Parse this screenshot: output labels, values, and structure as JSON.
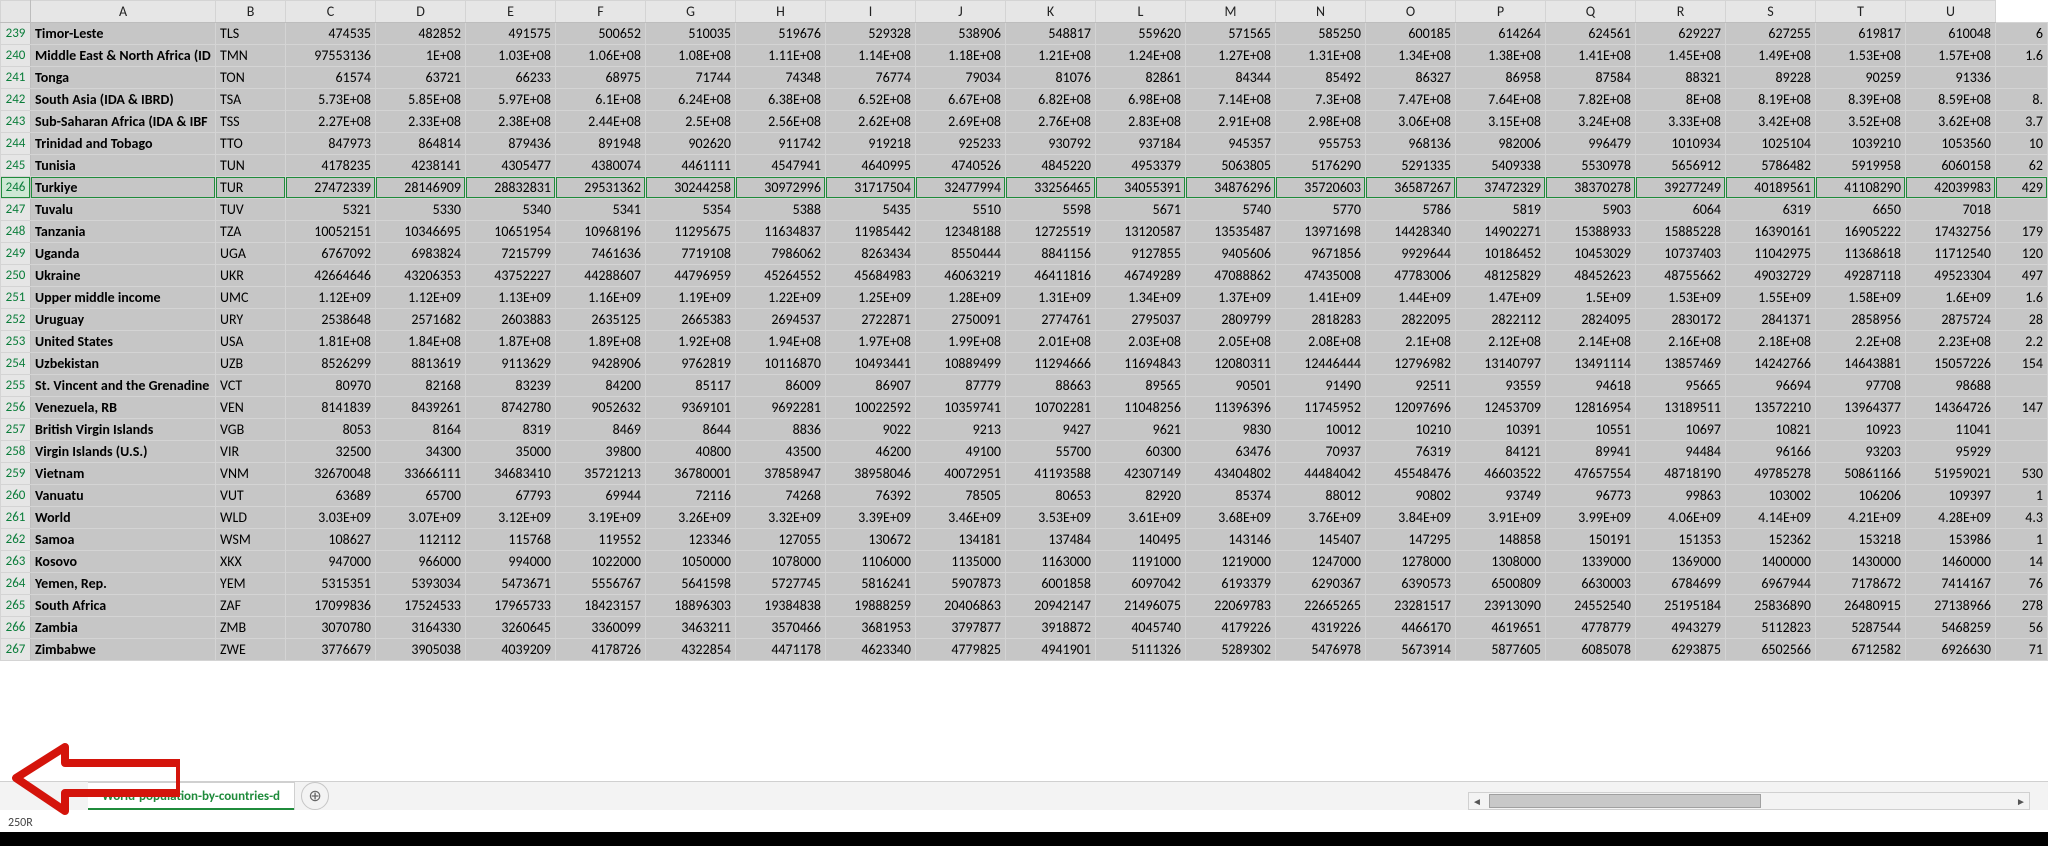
{
  "columns": [
    "",
    "A",
    "B",
    "C",
    "D",
    "E",
    "F",
    "G",
    "H",
    "I",
    "J",
    "K",
    "L",
    "M",
    "N",
    "O",
    "P",
    "Q",
    "R",
    "S",
    "T",
    "U"
  ],
  "col_widths": [
    "30px",
    "185px",
    "70px",
    "90px",
    "90px",
    "90px",
    "90px",
    "90px",
    "90px",
    "90px",
    "90px",
    "90px",
    "90px",
    "90px",
    "90px",
    "90px",
    "90px",
    "90px",
    "90px",
    "90px",
    "90px",
    "90px"
  ],
  "highlight_row": 246,
  "sheet_tab": "World-population-by-countries-d",
  "status_text": "250R",
  "addsheet_glyph": "⊕",
  "scroll_left_glyph": "◄",
  "scroll_right_glyph": "►",
  "rows": [
    {
      "n": 239,
      "a": "Timor-Leste",
      "b": "TLS",
      "v": [
        "474535",
        "482852",
        "491575",
        "500652",
        "510035",
        "519676",
        "529328",
        "538906",
        "548817",
        "559620",
        "571565",
        "585250",
        "600185",
        "614264",
        "624561",
        "629227",
        "627255",
        "619817",
        "610048",
        "6"
      ]
    },
    {
      "n": 240,
      "a": "Middle East & North Africa (ID",
      "b": "TMN",
      "v": [
        "97553136",
        "1E+08",
        "1.03E+08",
        "1.06E+08",
        "1.08E+08",
        "1.11E+08",
        "1.14E+08",
        "1.18E+08",
        "1.21E+08",
        "1.24E+08",
        "1.27E+08",
        "1.31E+08",
        "1.34E+08",
        "1.38E+08",
        "1.41E+08",
        "1.45E+08",
        "1.49E+08",
        "1.53E+08",
        "1.57E+08",
        "1.6"
      ]
    },
    {
      "n": 241,
      "a": "Tonga",
      "b": "TON",
      "v": [
        "61574",
        "63721",
        "66233",
        "68975",
        "71744",
        "74348",
        "76774",
        "79034",
        "81076",
        "82861",
        "84344",
        "85492",
        "86327",
        "86958",
        "87584",
        "88321",
        "89228",
        "90259",
        "91336",
        ""
      ]
    },
    {
      "n": 242,
      "a": "South Asia (IDA & IBRD)",
      "b": "TSA",
      "v": [
        "5.73E+08",
        "5.85E+08",
        "5.97E+08",
        "6.1E+08",
        "6.24E+08",
        "6.38E+08",
        "6.52E+08",
        "6.67E+08",
        "6.82E+08",
        "6.98E+08",
        "7.14E+08",
        "7.3E+08",
        "7.47E+08",
        "7.64E+08",
        "7.82E+08",
        "8E+08",
        "8.19E+08",
        "8.39E+08",
        "8.59E+08",
        "8."
      ]
    },
    {
      "n": 243,
      "a": "Sub-Saharan Africa (IDA & IBF",
      "b": "TSS",
      "v": [
        "2.27E+08",
        "2.33E+08",
        "2.38E+08",
        "2.44E+08",
        "2.5E+08",
        "2.56E+08",
        "2.62E+08",
        "2.69E+08",
        "2.76E+08",
        "2.83E+08",
        "2.91E+08",
        "2.98E+08",
        "3.06E+08",
        "3.15E+08",
        "3.24E+08",
        "3.33E+08",
        "3.42E+08",
        "3.52E+08",
        "3.62E+08",
        "3.7"
      ]
    },
    {
      "n": 244,
      "a": "Trinidad and Tobago",
      "b": "TTO",
      "v": [
        "847973",
        "864814",
        "879436",
        "891948",
        "902620",
        "911742",
        "919218",
        "925233",
        "930792",
        "937184",
        "945357",
        "955753",
        "968136",
        "982006",
        "996479",
        "1010934",
        "1025104",
        "1039210",
        "1053560",
        "10"
      ]
    },
    {
      "n": 245,
      "a": "Tunisia",
      "b": "TUN",
      "v": [
        "4178235",
        "4238141",
        "4305477",
        "4380074",
        "4461111",
        "4547941",
        "4640995",
        "4740526",
        "4845220",
        "4953379",
        "5063805",
        "5176290",
        "5291335",
        "5409338",
        "5530978",
        "5656912",
        "5786482",
        "5919958",
        "6060158",
        "62"
      ]
    },
    {
      "n": 246,
      "a": "Turkiye",
      "b": "TUR",
      "v": [
        "27472339",
        "28146909",
        "28832831",
        "29531362",
        "30244258",
        "30972996",
        "31717504",
        "32477994",
        "33256465",
        "34055391",
        "34876296",
        "35720603",
        "36587267",
        "37472329",
        "38370278",
        "39277249",
        "40189561",
        "41108290",
        "42039983",
        "429"
      ]
    },
    {
      "n": 247,
      "a": "Tuvalu",
      "b": "TUV",
      "v": [
        "5321",
        "5330",
        "5340",
        "5341",
        "5354",
        "5388",
        "5435",
        "5510",
        "5598",
        "5671",
        "5740",
        "5770",
        "5786",
        "5819",
        "5903",
        "6064",
        "6319",
        "6650",
        "7018",
        ""
      ]
    },
    {
      "n": 248,
      "a": "Tanzania",
      "b": "TZA",
      "v": [
        "10052151",
        "10346695",
        "10651954",
        "10968196",
        "11295675",
        "11634837",
        "11985442",
        "12348188",
        "12725519",
        "13120587",
        "13535487",
        "13971698",
        "14428340",
        "14902271",
        "15388933",
        "15885228",
        "16390161",
        "16905222",
        "17432756",
        "179"
      ]
    },
    {
      "n": 249,
      "a": "Uganda",
      "b": "UGA",
      "v": [
        "6767092",
        "6983824",
        "7215799",
        "7461636",
        "7719108",
        "7986062",
        "8263434",
        "8550444",
        "8841156",
        "9127855",
        "9405606",
        "9671856",
        "9929644",
        "10186452",
        "10453029",
        "10737403",
        "11042975",
        "11368618",
        "11712540",
        "120"
      ]
    },
    {
      "n": 250,
      "a": "Ukraine",
      "b": "UKR",
      "v": [
        "42664646",
        "43206353",
        "43752227",
        "44288607",
        "44796959",
        "45264552",
        "45684983",
        "46063219",
        "46411816",
        "46749289",
        "47088862",
        "47435008",
        "47783006",
        "48125829",
        "48452623",
        "48755662",
        "49032729",
        "49287118",
        "49523304",
        "497"
      ]
    },
    {
      "n": 251,
      "a": "Upper middle income",
      "b": "UMC",
      "v": [
        "1.12E+09",
        "1.12E+09",
        "1.13E+09",
        "1.16E+09",
        "1.19E+09",
        "1.22E+09",
        "1.25E+09",
        "1.28E+09",
        "1.31E+09",
        "1.34E+09",
        "1.37E+09",
        "1.41E+09",
        "1.44E+09",
        "1.47E+09",
        "1.5E+09",
        "1.53E+09",
        "1.55E+09",
        "1.58E+09",
        "1.6E+09",
        "1.6"
      ]
    },
    {
      "n": 252,
      "a": "Uruguay",
      "b": "URY",
      "v": [
        "2538648",
        "2571682",
        "2603883",
        "2635125",
        "2665383",
        "2694537",
        "2722871",
        "2750091",
        "2774761",
        "2795037",
        "2809799",
        "2818283",
        "2822095",
        "2822112",
        "2824095",
        "2830172",
        "2841371",
        "2858956",
        "2875724",
        "28"
      ]
    },
    {
      "n": 253,
      "a": "United States",
      "b": "USA",
      "v": [
        "1.81E+08",
        "1.84E+08",
        "1.87E+08",
        "1.89E+08",
        "1.92E+08",
        "1.94E+08",
        "1.97E+08",
        "1.99E+08",
        "2.01E+08",
        "2.03E+08",
        "2.05E+08",
        "2.08E+08",
        "2.1E+08",
        "2.12E+08",
        "2.14E+08",
        "2.16E+08",
        "2.18E+08",
        "2.2E+08",
        "2.23E+08",
        "2.2"
      ]
    },
    {
      "n": 254,
      "a": "Uzbekistan",
      "b": "UZB",
      "v": [
        "8526299",
        "8813619",
        "9113629",
        "9428906",
        "9762819",
        "10116870",
        "10493441",
        "10889499",
        "11294666",
        "11694843",
        "12080311",
        "12446444",
        "12796982",
        "13140797",
        "13491114",
        "13857469",
        "14242766",
        "14643881",
        "15057226",
        "154"
      ]
    },
    {
      "n": 255,
      "a": "St. Vincent and the Grenadine",
      "b": "VCT",
      "v": [
        "80970",
        "82168",
        "83239",
        "84200",
        "85117",
        "86009",
        "86907",
        "87779",
        "88663",
        "89565",
        "90501",
        "91490",
        "92511",
        "93559",
        "94618",
        "95665",
        "96694",
        "97708",
        "98688",
        ""
      ]
    },
    {
      "n": 256,
      "a": "Venezuela, RB",
      "b": "VEN",
      "v": [
        "8141839",
        "8439261",
        "8742780",
        "9052632",
        "9369101",
        "9692281",
        "10022592",
        "10359741",
        "10702281",
        "11048256",
        "11396396",
        "11745952",
        "12097696",
        "12453709",
        "12816954",
        "13189511",
        "13572210",
        "13964377",
        "14364726",
        "147"
      ]
    },
    {
      "n": 257,
      "a": "British Virgin Islands",
      "b": "VGB",
      "v": [
        "8053",
        "8164",
        "8319",
        "8469",
        "8644",
        "8836",
        "9022",
        "9213",
        "9427",
        "9621",
        "9830",
        "10012",
        "10210",
        "10391",
        "10551",
        "10697",
        "10821",
        "10923",
        "11041",
        ""
      ]
    },
    {
      "n": 258,
      "a": "Virgin Islands (U.S.)",
      "b": "VIR",
      "v": [
        "32500",
        "34300",
        "35000",
        "39800",
        "40800",
        "43500",
        "46200",
        "49100",
        "55700",
        "60300",
        "63476",
        "70937",
        "76319",
        "84121",
        "89941",
        "94484",
        "96166",
        "93203",
        "95929",
        ""
      ]
    },
    {
      "n": 259,
      "a": "Vietnam",
      "b": "VNM",
      "v": [
        "32670048",
        "33666111",
        "34683410",
        "35721213",
        "36780001",
        "37858947",
        "38958046",
        "40072951",
        "41193588",
        "42307149",
        "43404802",
        "44484042",
        "45548476",
        "46603522",
        "47657554",
        "48718190",
        "49785278",
        "50861166",
        "51959021",
        "530"
      ]
    },
    {
      "n": 260,
      "a": "Vanuatu",
      "b": "VUT",
      "v": [
        "63689",
        "65700",
        "67793",
        "69944",
        "72116",
        "74268",
        "76392",
        "78505",
        "80653",
        "82920",
        "85374",
        "88012",
        "90802",
        "93749",
        "96773",
        "99863",
        "103002",
        "106206",
        "109397",
        "1"
      ]
    },
    {
      "n": 261,
      "a": "World",
      "b": "WLD",
      "v": [
        "3.03E+09",
        "3.07E+09",
        "3.12E+09",
        "3.19E+09",
        "3.26E+09",
        "3.32E+09",
        "3.39E+09",
        "3.46E+09",
        "3.53E+09",
        "3.61E+09",
        "3.68E+09",
        "3.76E+09",
        "3.84E+09",
        "3.91E+09",
        "3.99E+09",
        "4.06E+09",
        "4.14E+09",
        "4.21E+09",
        "4.28E+09",
        "4.3"
      ]
    },
    {
      "n": 262,
      "a": "Samoa",
      "b": "WSM",
      "v": [
        "108627",
        "112112",
        "115768",
        "119552",
        "123346",
        "127055",
        "130672",
        "134181",
        "137484",
        "140495",
        "143146",
        "145407",
        "147295",
        "148858",
        "150191",
        "151353",
        "152362",
        "153218",
        "153986",
        "1"
      ]
    },
    {
      "n": 263,
      "a": "Kosovo",
      "b": "XKX",
      "v": [
        "947000",
        "966000",
        "994000",
        "1022000",
        "1050000",
        "1078000",
        "1106000",
        "1135000",
        "1163000",
        "1191000",
        "1219000",
        "1247000",
        "1278000",
        "1308000",
        "1339000",
        "1369000",
        "1400000",
        "1430000",
        "1460000",
        "14"
      ]
    },
    {
      "n": 264,
      "a": "Yemen, Rep.",
      "b": "YEM",
      "v": [
        "5315351",
        "5393034",
        "5473671",
        "5556767",
        "5641598",
        "5727745",
        "5816241",
        "5907873",
        "6001858",
        "6097042",
        "6193379",
        "6290367",
        "6390573",
        "6500809",
        "6630003",
        "6784699",
        "6967944",
        "7178672",
        "7414167",
        "76"
      ]
    },
    {
      "n": 265,
      "a": "South Africa",
      "b": "ZAF",
      "v": [
        "17099836",
        "17524533",
        "17965733",
        "18423157",
        "18896303",
        "19384838",
        "19888259",
        "20406863",
        "20942147",
        "21496075",
        "22069783",
        "22665265",
        "23281517",
        "23913090",
        "24552540",
        "25195184",
        "25836890",
        "26480915",
        "27138966",
        "278"
      ]
    },
    {
      "n": 266,
      "a": "Zambia",
      "b": "ZMB",
      "v": [
        "3070780",
        "3164330",
        "3260645",
        "3360099",
        "3463211",
        "3570466",
        "3681953",
        "3797877",
        "3918872",
        "4045740",
        "4179226",
        "4319226",
        "4466170",
        "4619651",
        "4778779",
        "4943279",
        "5112823",
        "5287544",
        "5468259",
        "56"
      ]
    },
    {
      "n": 267,
      "a": "Zimbabwe",
      "b": "ZWE",
      "v": [
        "3776679",
        "3905038",
        "4039209",
        "4178726",
        "4322854",
        "4471178",
        "4623340",
        "4779825",
        "4941901",
        "5111326",
        "5289302",
        "5476978",
        "5673914",
        "5877605",
        "6085078",
        "6293875",
        "6502566",
        "6712582",
        "6926630",
        "71"
      ]
    }
  ],
  "blank_rows": []
}
